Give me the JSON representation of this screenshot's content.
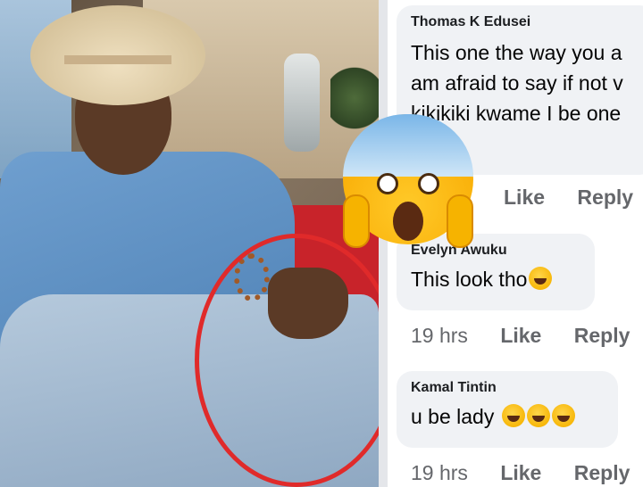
{
  "comments": [
    {
      "author": "Thomas K Edusei",
      "lines": [
        "This one the way you a",
        "am afraid to say if not v",
        "kikikiki kwame I be one"
      ],
      "time": "",
      "like": "Like",
      "reply": "Reply"
    },
    {
      "author": "Evelyn Awuku",
      "lines": [
        "This look tho"
      ],
      "emojis": [
        "rolling-laughing-emoji"
      ],
      "time": "19 hrs",
      "like": "Like",
      "reply": "Reply"
    },
    {
      "author": "Kamal Tintin",
      "lines": [
        "u be lady "
      ],
      "emojis": [
        "joy-emoji",
        "joy-emoji",
        "joy-emoji"
      ],
      "time": "19 hrs",
      "like": "Like",
      "reply": "Reply"
    }
  ],
  "overlay": {
    "icon": "screaming-face-emoji"
  },
  "annotation": {
    "color": "#e02a2a",
    "shape": "red-circle-highlight"
  },
  "colors": {
    "bubble": "#f0f2f5",
    "meta": "#65676b",
    "text": "#050505"
  }
}
